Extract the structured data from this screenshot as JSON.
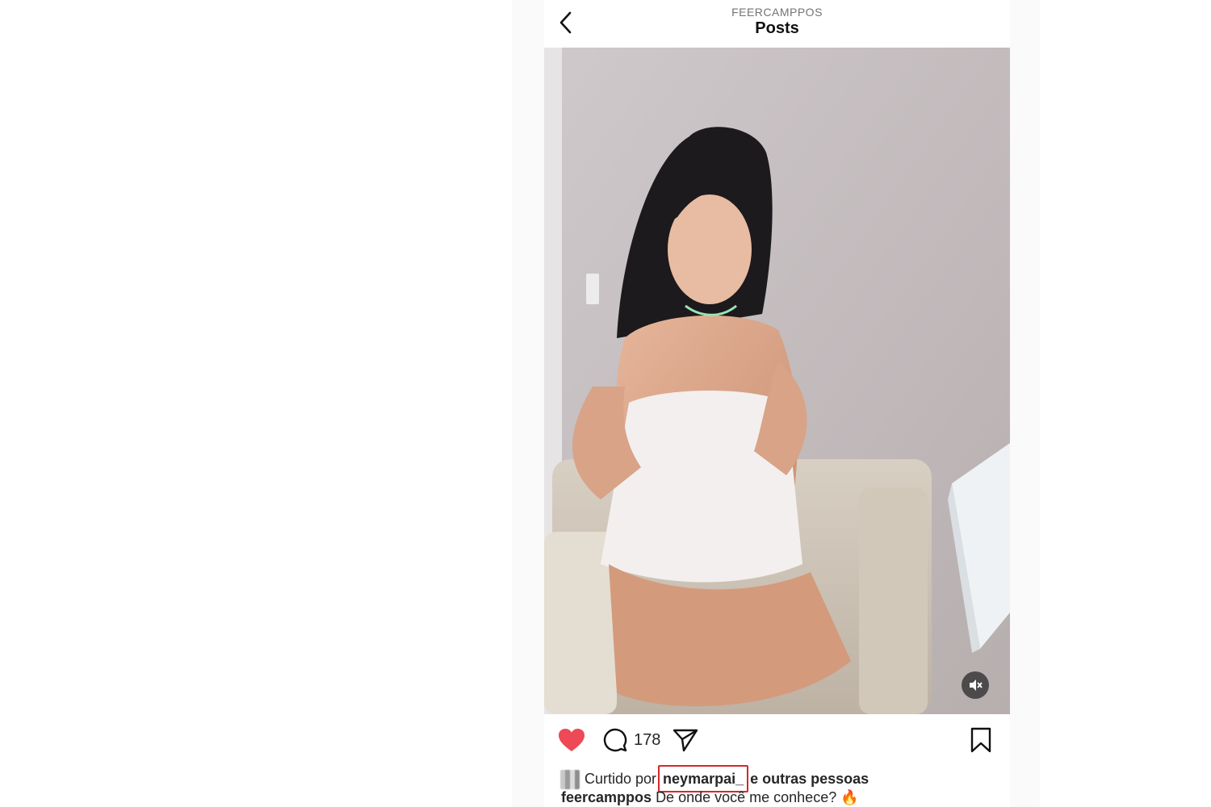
{
  "header": {
    "account_name": "FEERCAMPPOS",
    "title": "Posts"
  },
  "post": {
    "media_description_icon": "muted-speaker-icon",
    "liked": true,
    "like_color": "#ed4956",
    "comment_count": "178",
    "likes_prefix": "Curtido por",
    "liked_by_user": "neymarpai_",
    "likes_suffix": "e outras pessoas",
    "highlight_color": "#d62828",
    "caption_user": "feercamppos",
    "caption_text": "De onde você me conhece? 🔥"
  }
}
